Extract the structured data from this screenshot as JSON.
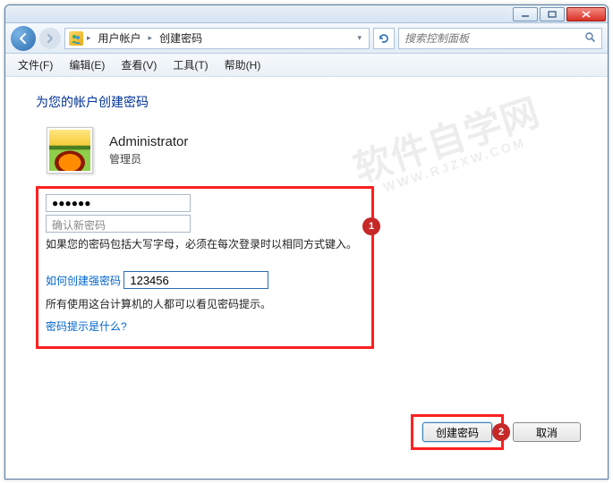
{
  "titlebar": {
    "min_label": "–",
    "max_label": "▭",
    "close_label": "✕"
  },
  "navbar": {
    "back_icon": "←",
    "fwd_icon": "→",
    "refresh_icon": "↻",
    "breadcrumb": {
      "icon_glyph": "👥",
      "items": [
        "用户帐户",
        "创建密码"
      ]
    },
    "search_placeholder": "搜索控制面板",
    "search_icon": "🔍"
  },
  "menubar": {
    "items": [
      {
        "label": "文件(F)"
      },
      {
        "label": "编辑(E)"
      },
      {
        "label": "查看(V)"
      },
      {
        "label": "工具(T)"
      },
      {
        "label": "帮助(H)"
      }
    ]
  },
  "page": {
    "title": "为您的帐户创建密码",
    "user": {
      "name": "Administrator",
      "role": "管理员"
    },
    "form": {
      "password_value": "●●●●●●",
      "confirm_placeholder": "确认新密码",
      "case_hint": "如果您的密码包括大写字母，必须在每次登录时以相同方式键入。",
      "strong_link": "如何创建强密码",
      "hint_value": "123456",
      "hint_desc": "所有使用这台计算机的人都可以看见密码提示。",
      "hint_what_link": "密码提示是什么?"
    },
    "buttons": {
      "create": "创建密码",
      "cancel": "取消"
    },
    "annotations": {
      "badge1": "1",
      "badge2": "2"
    }
  },
  "watermark": {
    "line1": "软件自学网",
    "line2": "WWW.RJZXW.COM"
  }
}
